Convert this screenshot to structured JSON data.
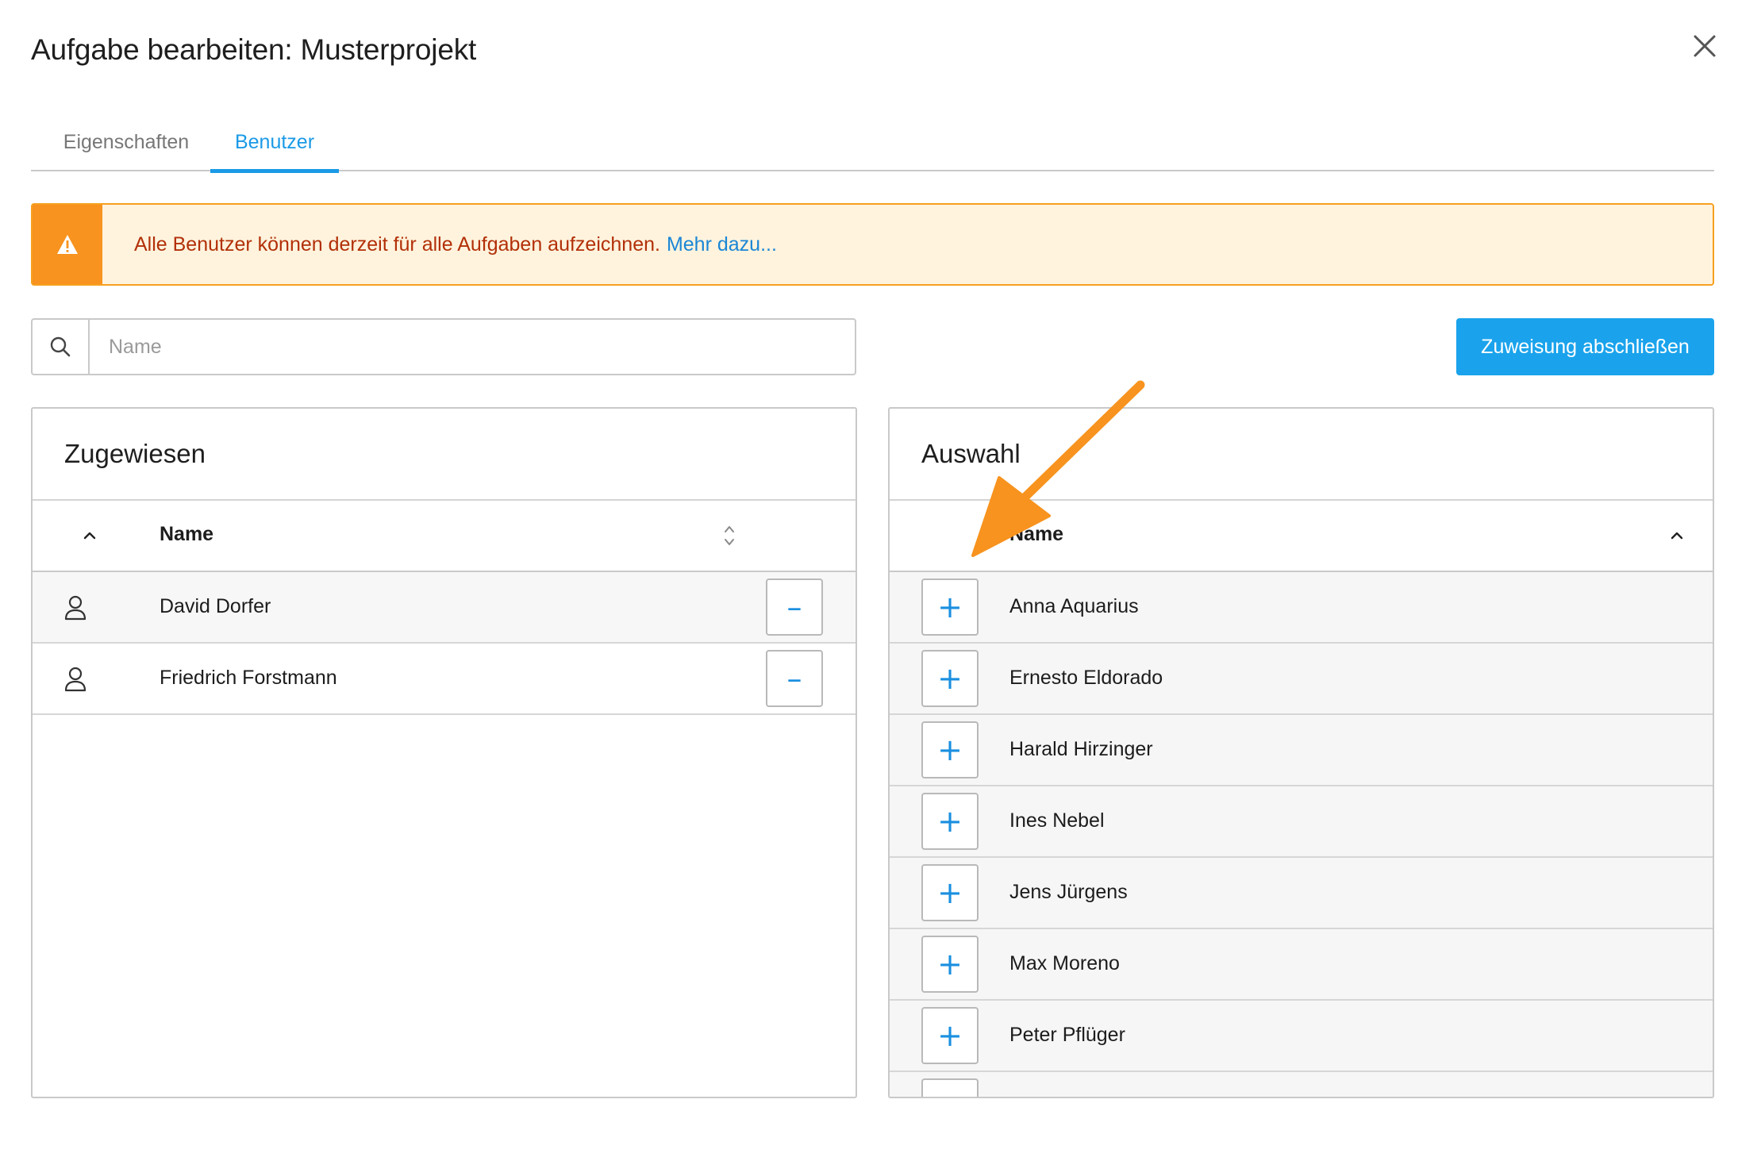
{
  "dialog": {
    "title": "Aufgabe bearbeiten: Musterprojekt"
  },
  "tabs": [
    {
      "label": "Eigenschaften",
      "active": false
    },
    {
      "label": "Benutzer",
      "active": true
    }
  ],
  "alert": {
    "message": "Alle Benutzer können derzeit für alle Aufgaben aufzeichnen.",
    "link": "Mehr dazu..."
  },
  "search": {
    "placeholder": "Name",
    "value": ""
  },
  "actions": {
    "finish_label": "Zuweisung abschließen"
  },
  "assigned": {
    "title": "Zugewiesen",
    "column_header": "Name",
    "rows": [
      {
        "name": "David Dorfer"
      },
      {
        "name": "Friedrich Forstmann"
      }
    ]
  },
  "selection": {
    "title": "Auswahl",
    "column_header": "Name",
    "rows": [
      {
        "name": "Anna Aquarius"
      },
      {
        "name": "Ernesto Eldorado"
      },
      {
        "name": "Harald Hirzinger"
      },
      {
        "name": "Ines Nebel"
      },
      {
        "name": "Jens Jürgens"
      },
      {
        "name": "Max Moreno"
      },
      {
        "name": "Peter Pflüger"
      }
    ]
  },
  "colors": {
    "accent": "#1a9ae6",
    "primary_button": "#1aa3ec",
    "warning": "#f7931e",
    "warning_background": "#fff3dd",
    "warning_text": "#b23008",
    "annotation_arrow": "#f7931e"
  },
  "icons": {
    "close": "close-icon",
    "warning": "warning-icon",
    "search": "search-icon",
    "user": "user-icon",
    "remove": "minus-icon",
    "add": "plus-icon",
    "sort_asc": "chevron-up-icon",
    "sort_both": "sort-icon"
  }
}
